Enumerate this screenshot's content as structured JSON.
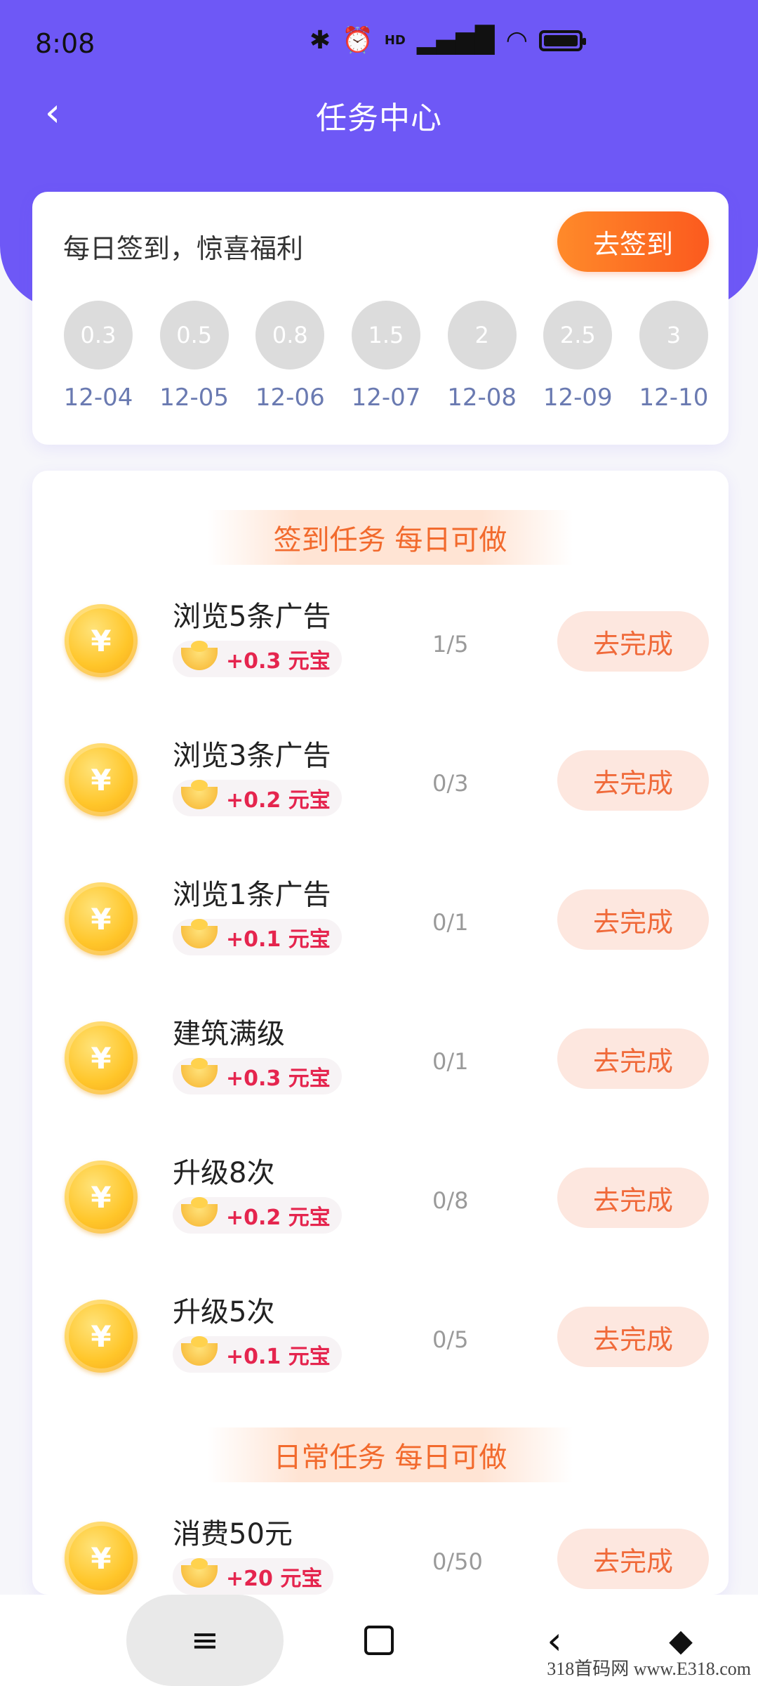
{
  "status": {
    "time": "8:08",
    "network_badge": "HD"
  },
  "header": {
    "title": "任务中心",
    "back_icon": "‹"
  },
  "signin": {
    "title": "每日签到，惊喜福利",
    "button": "去签到",
    "days": [
      {
        "value": "0.3",
        "date": "12-04"
      },
      {
        "value": "0.5",
        "date": "12-05"
      },
      {
        "value": "0.8",
        "date": "12-06"
      },
      {
        "value": "1.5",
        "date": "12-07"
      },
      {
        "value": "2",
        "date": "12-08"
      },
      {
        "value": "2.5",
        "date": "12-09"
      },
      {
        "value": "3",
        "date": "12-10"
      }
    ]
  },
  "sections": [
    {
      "title": "签到任务 每日可做",
      "tasks": [
        {
          "name": "浏览5条广告",
          "reward": "+0.3 元宝",
          "progress": "1/5",
          "button": "去完成"
        },
        {
          "name": "浏览3条广告",
          "reward": "+0.2 元宝",
          "progress": "0/3",
          "button": "去完成"
        },
        {
          "name": "浏览1条广告",
          "reward": "+0.1 元宝",
          "progress": "0/1",
          "button": "去完成"
        },
        {
          "name": "建筑满级",
          "reward": "+0.3 元宝",
          "progress": "0/1",
          "button": "去完成"
        },
        {
          "name": "升级8次",
          "reward": "+0.2 元宝",
          "progress": "0/8",
          "button": "去完成"
        },
        {
          "name": "升级5次",
          "reward": "+0.1 元宝",
          "progress": "0/5",
          "button": "去完成"
        }
      ]
    },
    {
      "title": "日常任务 每日可做",
      "tasks": [
        {
          "name": "消费50元",
          "reward": "+20 元宝",
          "progress": "0/50",
          "button": "去完成"
        }
      ]
    }
  ],
  "coin_symbol": "¥",
  "navbar": {
    "menu_icon": "≡",
    "back_icon": "‹",
    "extra_icon": "◆"
  },
  "watermark": "318首码网 www.E318.com",
  "colors": {
    "primary": "#6e58f6",
    "accent": "#fb5a1e",
    "reward": "#e5254e"
  }
}
